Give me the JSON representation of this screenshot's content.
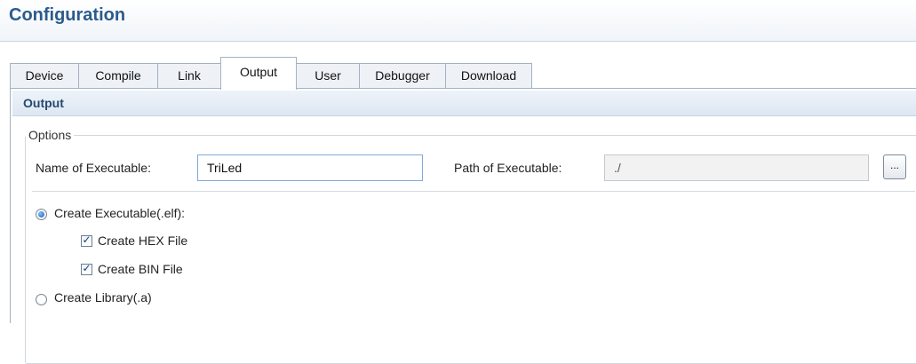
{
  "header": {
    "title": "Configuration"
  },
  "tabs": [
    {
      "label": "Device"
    },
    {
      "label": "Compile"
    },
    {
      "label": "Link"
    },
    {
      "label": "Output",
      "active": true
    },
    {
      "label": "User"
    },
    {
      "label": "Debugger"
    },
    {
      "label": "Download"
    }
  ],
  "section": {
    "title": "Output"
  },
  "options": {
    "legend": "Options",
    "name_label": "Name of Executable:",
    "name_value": "TriLed",
    "path_label": "Path of Executable:",
    "path_value": "./",
    "browse_label": "...",
    "create_executable": {
      "label": "Create Executable(.elf):",
      "selected": true
    },
    "create_hex": {
      "label": "Create HEX File",
      "checked": true
    },
    "create_bin": {
      "label": "Create BIN File",
      "checked": true
    },
    "create_library": {
      "label": "Create Library(.a)",
      "selected": false
    }
  },
  "colors": {
    "title": "#2b5b8c",
    "section_title": "#24496f",
    "input_border": "#7fa9d6"
  }
}
